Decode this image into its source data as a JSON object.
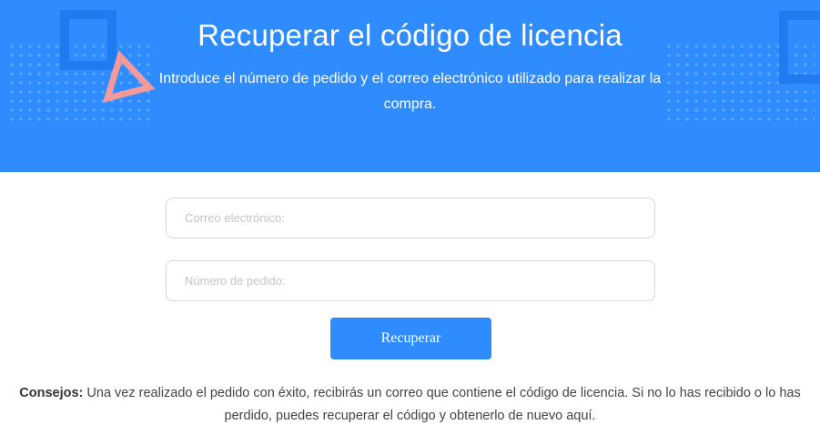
{
  "hero": {
    "title": "Recuperar el código de licencia",
    "subtitle": "Introduce el número de pedido y el correo electrónico utilizado para realizar la compra."
  },
  "form": {
    "email_placeholder": "Correo electrónico:",
    "email_value": "",
    "order_placeholder": "Número de pedido:",
    "order_value": "",
    "submit_label": "Recuperar"
  },
  "tips": {
    "label": "Consejos:",
    "text": " Una vez realizado el pedido con éxito, recibirás un correo que contiene el código de licencia. Si no lo has recibido o lo has perdido, puedes recuperar el código y obtenerlo de nuevo aquí."
  },
  "colors": {
    "accent": "#2e8cff",
    "triangle": "#f49a9a"
  }
}
